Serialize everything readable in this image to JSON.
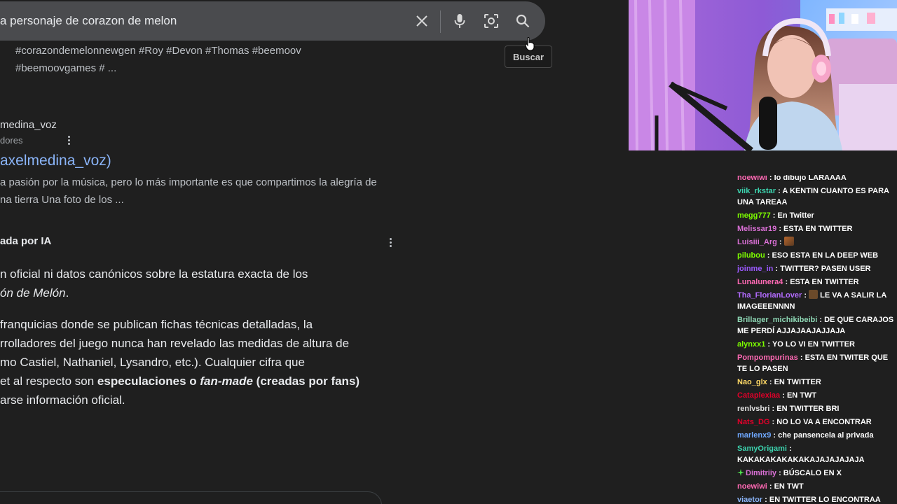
{
  "search": {
    "query": "a personaje de corazon de melon",
    "tooltip": "Buscar"
  },
  "results": {
    "prev_snippet_line1": "#corazondemelonnewgen #Roy #Devon #Thomas #beemoov",
    "prev_snippet_line2": "#beemoovgames # ...",
    "site_name": "medina_voz",
    "site_sub": "dores",
    "link_title": "axelmedina_voz)",
    "snippet_line1": "a pasión por la música, pero lo más importante es que compartimos la alegría de",
    "snippet_line2": "na tierra Una foto de los ..."
  },
  "ai_overview": {
    "heading": "ada por IA",
    "p1_line1": "n oficial ni datos canónicos sobre la estatura exacta de los",
    "p1_line2_italic": "ón de Melón",
    "p1_line2_end": ".",
    "p2_line1": "franquicias donde se publican fichas técnicas detalladas, la",
    "p2_line2": "rrolladores del juego nunca han revelado las medidas de altura de",
    "p2_line3": "mo Castiel, Nathaniel, Lysandro, etc.). Cualquier cifra que",
    "p2_line4_start": "et al respecto son ",
    "p2_line4_bold1": "especulaciones o ",
    "p2_line4_italic": "fan-made",
    "p2_line4_bold2": " (creadas por fans)",
    "p2_line5": "arse información oficial."
  },
  "chat": {
    "messages": [
      {
        "user": "noewiwi",
        "text": "lo dibujo LARAAAA",
        "color": "#ff69b4"
      },
      {
        "user": "viik_rkstar",
        "text": "A KENTIN CUANTO ES PARA UNA TAREAA",
        "color": "#3cd3ae"
      },
      {
        "user": "megg777",
        "text": "En Twitter",
        "color": "#7cfc00"
      },
      {
        "user": "Melissar19",
        "text": "ESTA EN TWITTER",
        "color": "#da70d6"
      },
      {
        "user": "Luisiii_Arg",
        "text": "",
        "color": "#da70d6",
        "emote": true
      },
      {
        "user": "pilubou",
        "text": "ESO ESTA EN LA DEEP WEB",
        "color": "#7cfc00"
      },
      {
        "user": "joinme_in",
        "text": "TWITTER? PASEN USER",
        "color": "#9b59ff"
      },
      {
        "user": "Lunalunera4",
        "text": "ESTA EN TWITTER",
        "color": "#ff69b4"
      },
      {
        "user": "Tha_FlorianLover",
        "text": "LE VA A SALIR LA IMAGEEENNNN",
        "color": "#b36bff",
        "emote2": true
      },
      {
        "user": "Brillager_michikibeibi",
        "text": "DE QUE CARAJOS ME PERDÍ AJJAJAAJAJJAJA",
        "color": "#8fd9b6"
      },
      {
        "user": "alynxx1",
        "text": "YO LO VI EN TWITTER",
        "color": "#7cfc00"
      },
      {
        "user": "Pompompurinas",
        "text": "ESTA EN TWITER QUE TE LO PASEN",
        "color": "#ff69b4"
      },
      {
        "user": "Nao_glx",
        "text": "EN TWITTER",
        "color": "#ffd966"
      },
      {
        "user": "Cataplexiaa",
        "text": "EN TWT",
        "color": "#e0002a"
      },
      {
        "user": "renlvsbri",
        "text": "EN TWITTER BRI",
        "color": "#e0e0e0"
      },
      {
        "user": "Nats_DG",
        "text": "NO LO VA A ENCONTRAR",
        "color": "#e0002a"
      },
      {
        "user": "marlenx9",
        "text": "che pansencela al privada",
        "color": "#6fa8ff"
      },
      {
        "user": "SamyOrigami",
        "text": "KAKAKAKAKAKAKAJAJAJAJAJA",
        "color": "#3cd3ae"
      },
      {
        "user": "Dimitriiy",
        "text": "BÚSCALO EN X",
        "color": "#da70d6",
        "badge": true
      },
      {
        "user": "noewiwi",
        "text": "EN TWT",
        "color": "#ff69b4"
      },
      {
        "user": "viaetor",
        "text": "EN TWITTER LO ENCONTRAA",
        "color": "#8ab4f8"
      }
    ]
  },
  "icons": {
    "clear": "close-icon",
    "voice": "microphone-icon",
    "lens": "camera-lens-icon",
    "search": "search-icon",
    "more": "kebab-menu-icon"
  }
}
